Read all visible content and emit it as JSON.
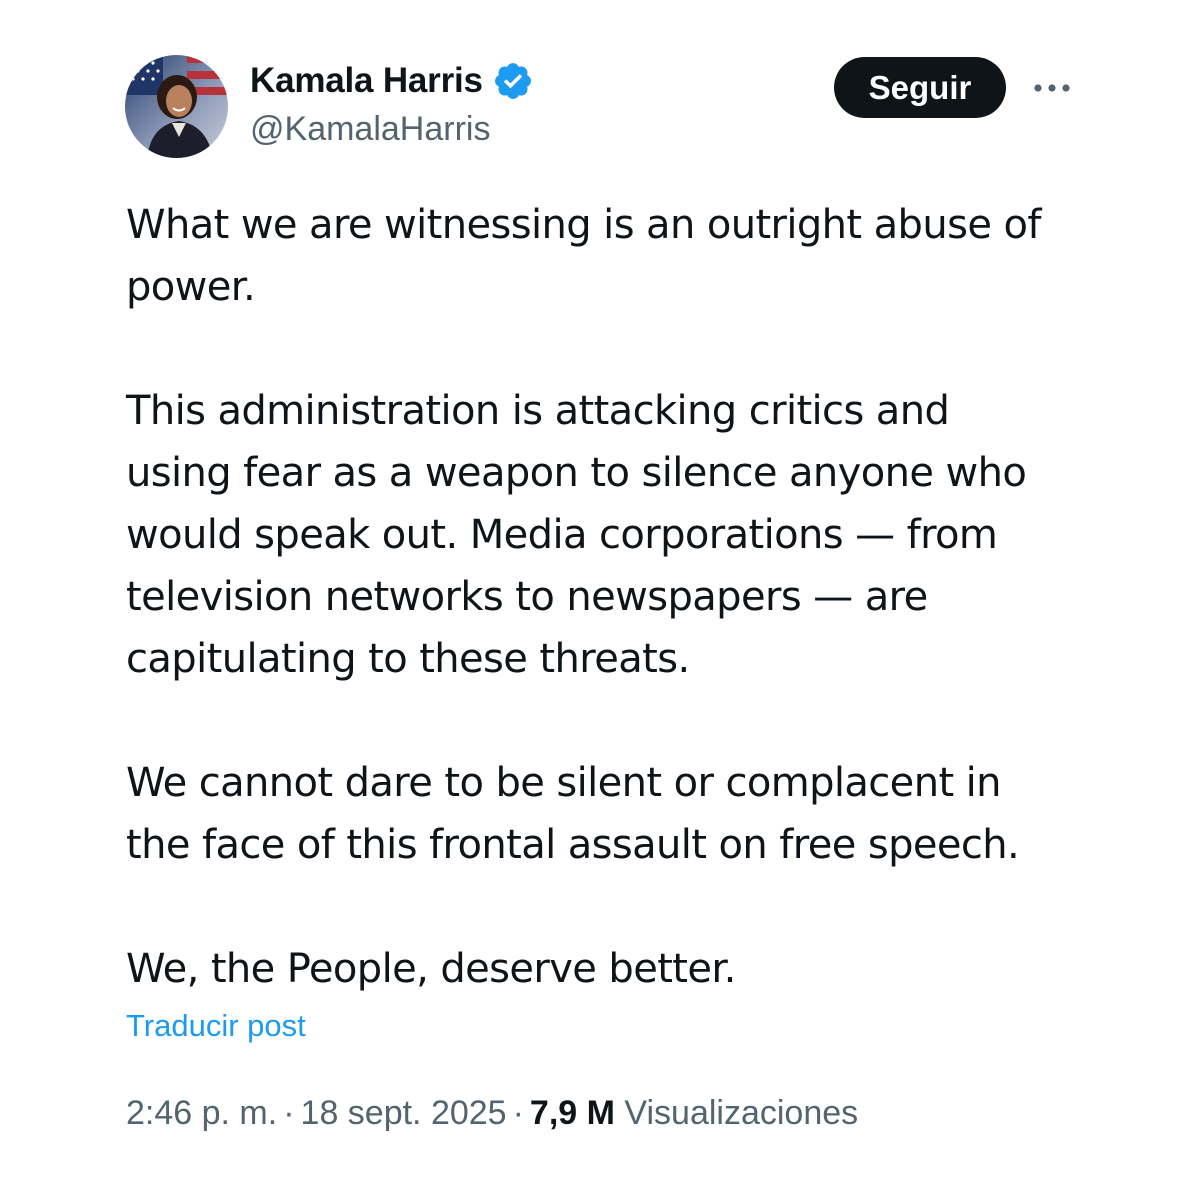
{
  "author": {
    "name": "Kamala Harris",
    "handle": "@KamalaHarris",
    "verified": true,
    "verified_color": "#1d9bf0"
  },
  "actions": {
    "follow_label": "Seguir",
    "more_icon": "more-horizontal-icon"
  },
  "post": {
    "paragraphs": [
      "What we are witnessing is an outright abuse of\npower.",
      "This administration is attacking critics and\nusing fear as a weapon to silence anyone who\nwould speak out. Media corporations — from\ntelevision networks to newspapers — are\ncapitulating to these threats.",
      "We cannot dare to be silent or complacent in\nthe face of this frontal assault on free speech.",
      "We, the People, deserve better."
    ],
    "translate_label": "Traducir post"
  },
  "meta": {
    "time": "2:46 p. m.",
    "separator": "·",
    "date": "18 sept. 2025",
    "views_count": "7,9 M",
    "views_label": "Visualizaciones"
  },
  "colors": {
    "text_primary": "#0f1419",
    "text_secondary": "#536471",
    "link": "#1d9bf0",
    "button_bg": "#0f1419"
  }
}
